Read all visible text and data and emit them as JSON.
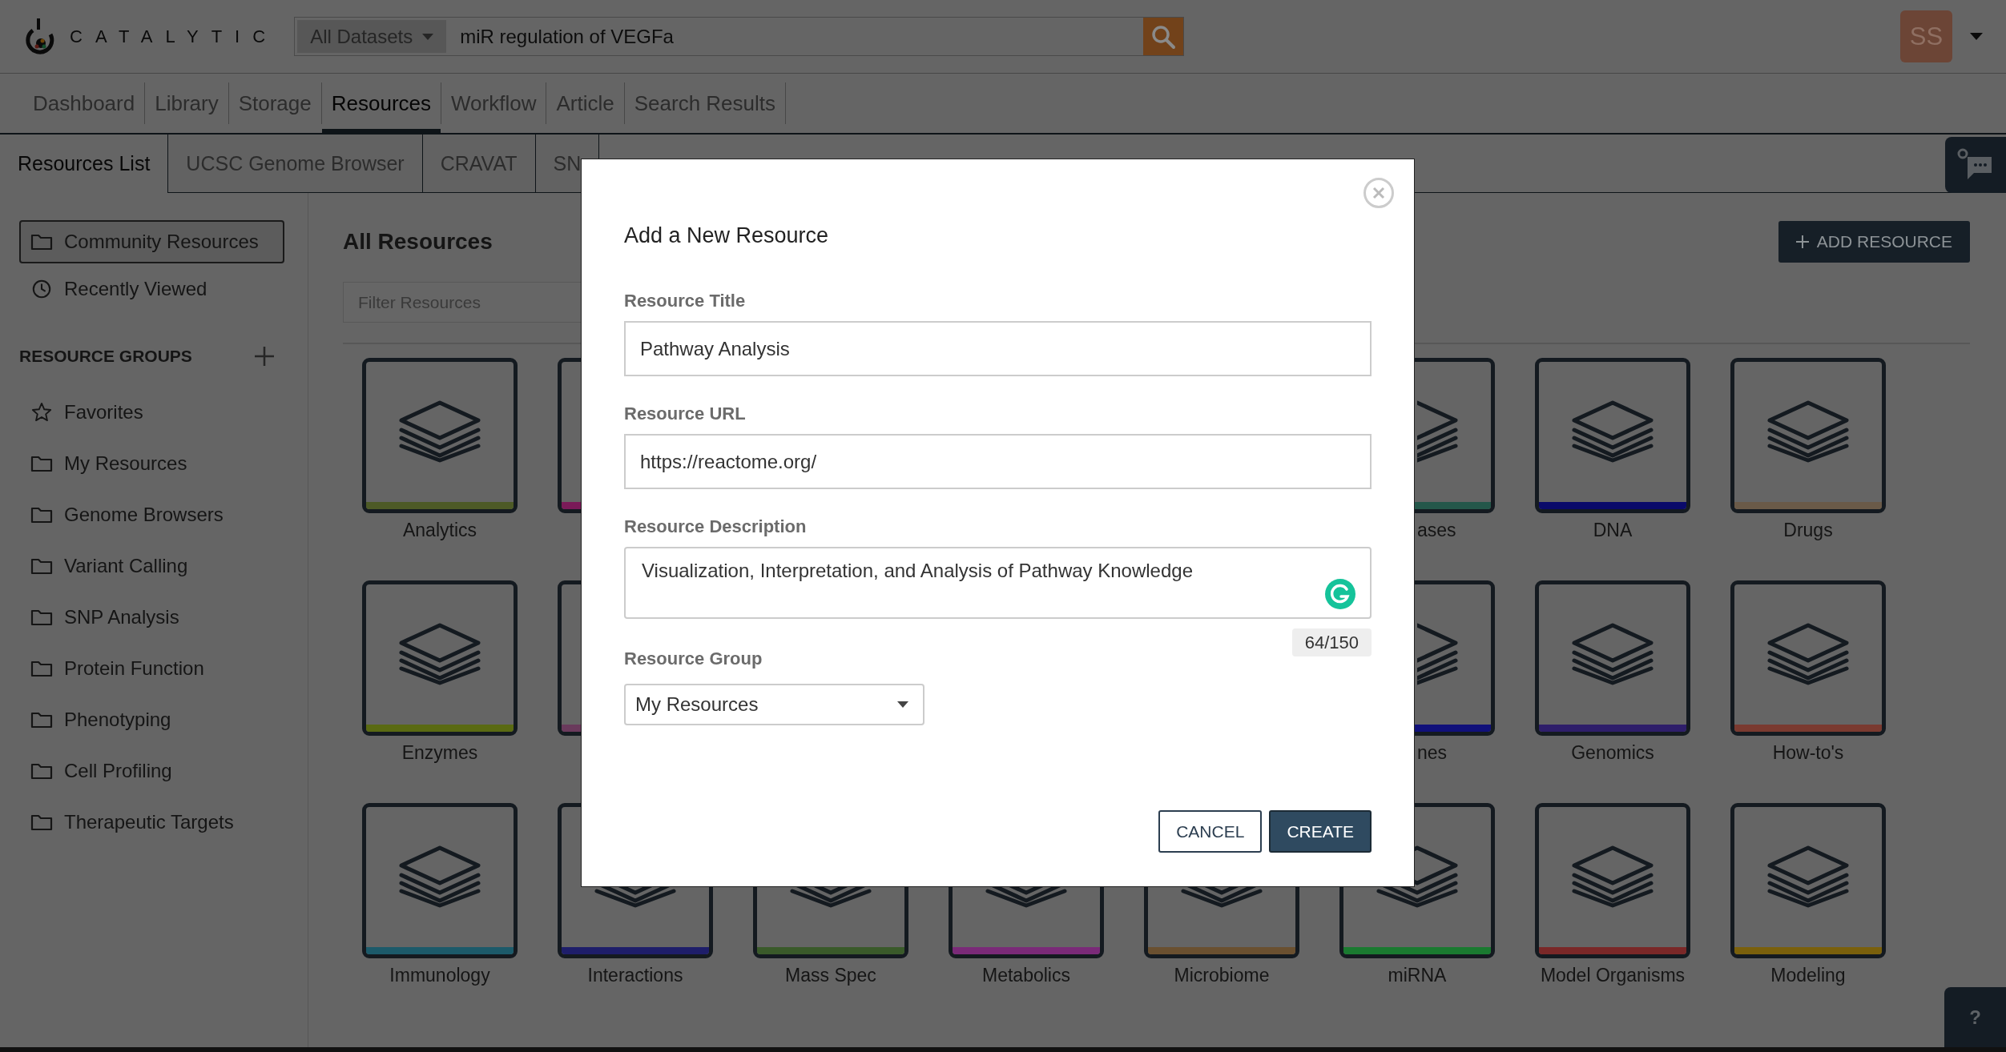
{
  "header": {
    "logo": "CATALYTIC",
    "dataset_menu": "All Datasets",
    "search": {
      "value": "miR regulation of VEGFa"
    },
    "avatar": "SS"
  },
  "nav_tabs": [
    {
      "label": "Dashboard",
      "selected": false
    },
    {
      "label": "Library",
      "selected": false
    },
    {
      "label": "Storage",
      "selected": false
    },
    {
      "label": "Resources",
      "selected": true
    },
    {
      "label": "Workflow",
      "selected": false
    },
    {
      "label": "Article",
      "selected": false
    },
    {
      "label": "Search Results",
      "selected": false
    }
  ],
  "sub_tabs": [
    {
      "label": "Resources List",
      "selected": true
    },
    {
      "label": "UCSC Genome Browser",
      "selected": false
    },
    {
      "label": "CRAVAT",
      "selected": false
    },
    {
      "label": "SN",
      "selected": false
    }
  ],
  "sidebar": {
    "views": [
      {
        "label": "Community Resources",
        "kind": "all",
        "selected": true
      },
      {
        "label": "Recently Viewed",
        "kind": "recent",
        "selected": false
      }
    ],
    "groups_heading": "RESOURCE GROUPS",
    "groups": [
      {
        "label": "Favorites",
        "kind": "favorites"
      },
      {
        "label": "My Resources",
        "kind": "group"
      },
      {
        "label": "Genome Browsers",
        "kind": "group"
      },
      {
        "label": "Variant Calling",
        "kind": "group"
      },
      {
        "label": "SNP Analysis",
        "kind": "group"
      },
      {
        "label": "Protein Function",
        "kind": "group"
      },
      {
        "label": "Phenotyping",
        "kind": "group"
      },
      {
        "label": "Cell Profiling",
        "kind": "group"
      },
      {
        "label": "Therapeutic Targets",
        "kind": "group"
      }
    ]
  },
  "main": {
    "title": "All Resources",
    "filter": {
      "placeholder": "Filter Resources"
    },
    "add_button": "ADD RESOURCE",
    "tile_rows": [
      {
        "tiles": [
          {
            "kind": "full",
            "label": "Analytics",
            "color": "#4d5a26"
          },
          {
            "kind": "edge",
            "color": "#7a1a58"
          },
          {
            "kind": "cut",
            "label": "ases",
            "color": "#24574a"
          },
          {
            "kind": "full",
            "label": "DNA",
            "color": "#0a0a6a"
          },
          {
            "kind": "full",
            "label": "Drugs",
            "color": "#6a5a48"
          }
        ]
      },
      {
        "tiles": [
          {
            "kind": "full",
            "label": "Enzymes",
            "color": "#5a6a12"
          },
          {
            "kind": "edge",
            "color": "#6a3a5c"
          },
          {
            "kind": "cut",
            "label": "nes",
            "color": "#10107a"
          },
          {
            "kind": "full",
            "label": "Genomics",
            "color": "#2e1e6a"
          },
          {
            "kind": "full",
            "label": "How-to's",
            "color": "#7a3a30"
          }
        ]
      },
      {
        "tiles": [
          {
            "kind": "full",
            "label": "Immunology",
            "color": "#1c5a6a"
          },
          {
            "kind": "full",
            "label": "Interactions",
            "color": "#1e1e6a"
          },
          {
            "kind": "full",
            "label": "Mass Spec",
            "color": "#3a5a2a"
          },
          {
            "kind": "full",
            "label": "Metabolics",
            "color": "#7a2a78"
          },
          {
            "kind": "full",
            "label": "Microbiome",
            "color": "#6a5030"
          },
          {
            "kind": "full",
            "label": "miRNA",
            "color": "#1a7a30"
          },
          {
            "kind": "full",
            "label": "Model Organisms",
            "color": "#7a2828"
          },
          {
            "kind": "full",
            "label": "Modeling",
            "color": "#7a600c"
          }
        ]
      }
    ]
  },
  "help_button": "?",
  "modal": {
    "title": "Add a New Resource",
    "fields": [
      {
        "label": "Resource Title",
        "kind": "text",
        "value": "Pathway Analysis"
      },
      {
        "label": "Resource URL",
        "kind": "text",
        "value": "https://reactome.org/"
      },
      {
        "label": "Resource Description",
        "kind": "textarea",
        "value": "Visualization, Interpretation, and Analysis of Pathway Knowledge",
        "counter": "64/150"
      },
      {
        "label": "Resource Group",
        "kind": "select",
        "value": "My Resources"
      }
    ],
    "buttons": [
      {
        "label": "CANCEL",
        "kind": "secondary"
      },
      {
        "label": "CREATE",
        "kind": "primary"
      }
    ]
  }
}
